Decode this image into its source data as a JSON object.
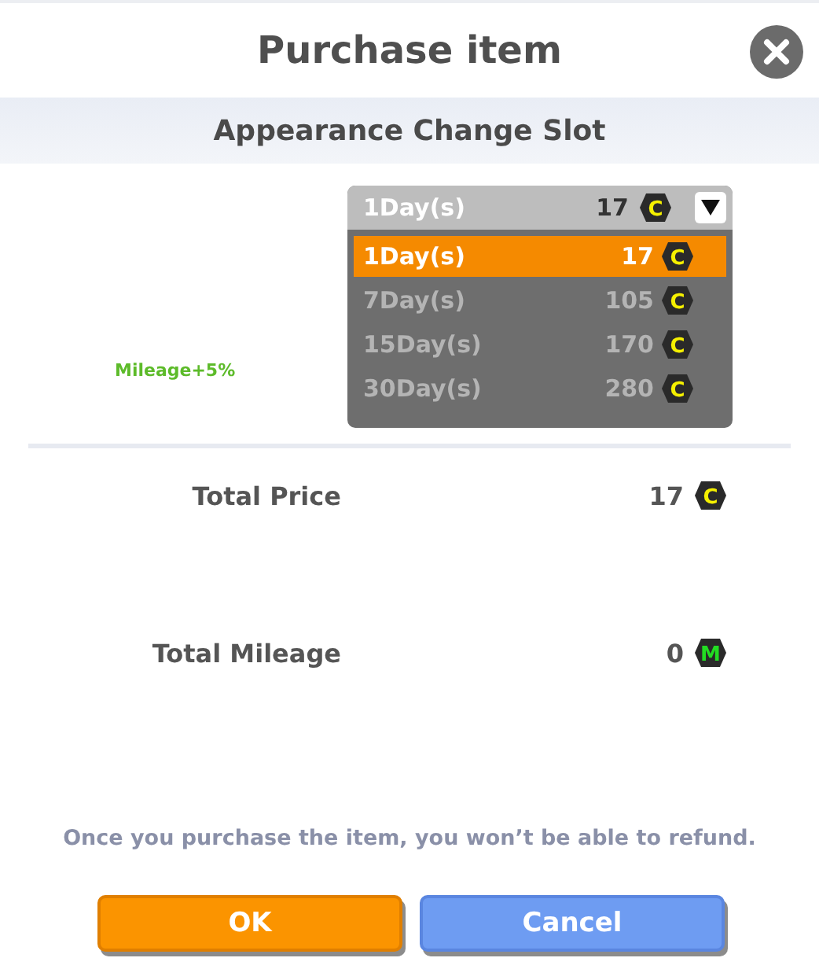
{
  "dialog": {
    "title": "Purchase item",
    "subtitle": "Appearance Change Slot"
  },
  "period_select": {
    "value": "1Day(s)",
    "price": "17",
    "coin": "C",
    "expanded": true,
    "options": [
      {
        "label": "1Day(s)",
        "price": "17",
        "coin": "C",
        "selected": true
      },
      {
        "label": "7Day(s)",
        "price": "105",
        "coin": "C",
        "selected": false
      },
      {
        "label": "15Day(s)",
        "price": "170",
        "coin": "C",
        "selected": false
      },
      {
        "label": "30Day(s)",
        "price": "280",
        "coin": "C",
        "selected": false
      }
    ]
  },
  "mileage_bonus": "Mileage+5%",
  "totals": [
    {
      "label": "Total Price",
      "value": "17",
      "coin": "C",
      "color": "#f5f000"
    },
    {
      "label": "Total Mileage",
      "value": "0",
      "coin": "M",
      "color": "#22dd22"
    }
  ],
  "notice": "Once you purchase the item, you won’t be able to refund.",
  "buttons": [
    {
      "label": "OK",
      "kind": "primary"
    },
    {
      "label": "Cancel",
      "kind": "secondary"
    }
  ]
}
